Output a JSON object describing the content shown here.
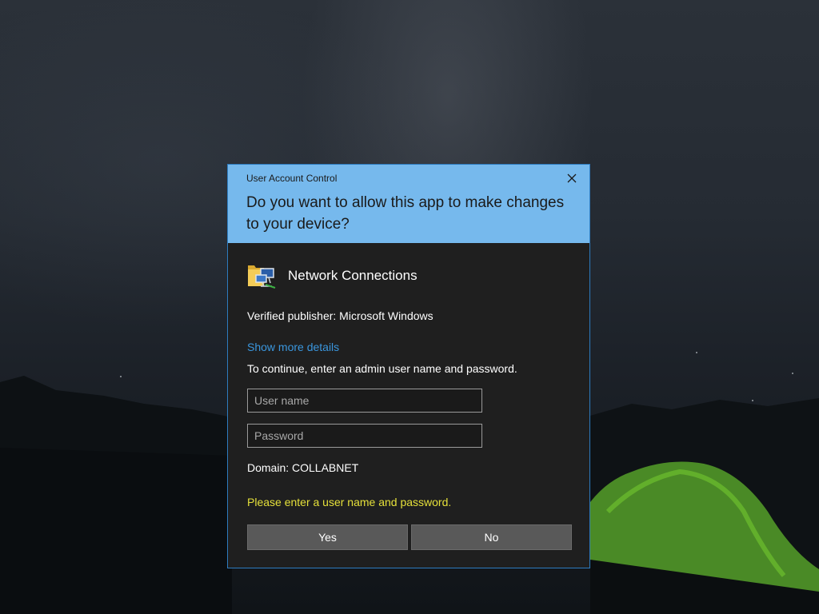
{
  "dialog": {
    "caption": "User Account Control",
    "close_icon": "close-icon",
    "prompt": "Do you want to allow this app to make changes to your device?",
    "app_icon": "network-connections-icon",
    "app_name": "Network Connections",
    "publisher": "Verified publisher: Microsoft Windows",
    "more_details": "Show more details",
    "instructions": "To continue, enter an admin user name and password.",
    "username": {
      "placeholder": "User name",
      "value": ""
    },
    "password": {
      "placeholder": "Password",
      "value": ""
    },
    "domain": "Domain: COLLABNET",
    "error": "Please enter a user name and password.",
    "yes_label": "Yes",
    "no_label": "No"
  },
  "colors": {
    "header": "#76b9ed",
    "body": "#1f1f1f",
    "link": "#3a96dd",
    "error": "#e5e03a",
    "button": "#595959",
    "border": "#2d7bbf"
  }
}
